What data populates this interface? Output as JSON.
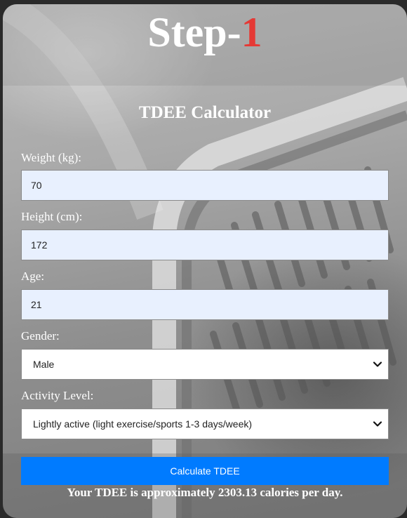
{
  "header": {
    "step_word": "Step-",
    "step_number": "1"
  },
  "form": {
    "title": "TDEE Calculator",
    "weight": {
      "label": "Weight (kg):",
      "value": "70"
    },
    "height": {
      "label": "Height (cm):",
      "value": "172"
    },
    "age": {
      "label": "Age:",
      "value": "21"
    },
    "gender": {
      "label": "Gender:",
      "selected": "Male"
    },
    "activity": {
      "label": "Activity Level:",
      "selected": "Lightly active (light exercise/sports 1-3 days/week)"
    },
    "button_label": "Calculate TDEE",
    "result_text": "Your TDEE is approximately 2303.13 calories per day."
  },
  "colors": {
    "accent_red": "#e53935",
    "button_blue": "#007bff",
    "input_fill": "#e8f0fe"
  },
  "icons": {
    "dropdown": "chevron-down-icon"
  }
}
